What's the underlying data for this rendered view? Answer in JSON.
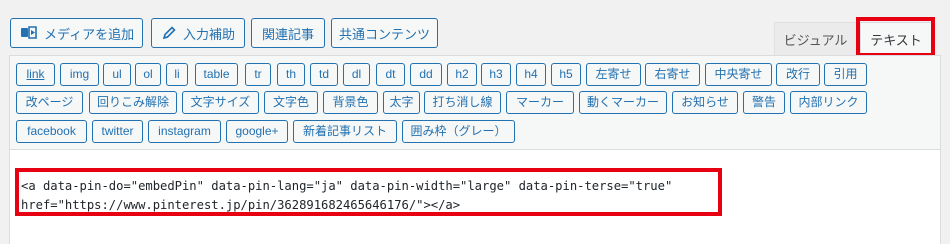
{
  "media_buttons": {
    "add_media": "メディアを追加",
    "input_assist": "入力補助",
    "related_article": "関連記事",
    "shared_content": "共通コンテンツ"
  },
  "tabs": {
    "visual": "ビジュアル",
    "text": "テキスト"
  },
  "quicktags": {
    "row1": [
      "link",
      "img",
      "ul",
      "ol",
      "li",
      "table",
      "tr",
      "th",
      "td",
      "dl",
      "dt",
      "dd",
      "h2",
      "h3",
      "h4",
      "h5",
      "左寄せ",
      "右寄せ",
      "中央寄せ",
      "改行",
      "引用"
    ],
    "row2": [
      "改ページ",
      "回りこみ解除",
      "文字サイズ",
      "文字色",
      "背景色",
      "太字",
      "打ち消し線",
      "マーカー",
      "動くマーカー",
      "お知らせ",
      "警告",
      "内部リンク"
    ],
    "row3": [
      "facebook",
      "twitter",
      "instagram",
      "google+",
      "新着記事リスト",
      "囲み枠（グレー）"
    ]
  },
  "editor": {
    "line1": "<a data-pin-do=\"embedPin\" data-pin-lang=\"ja\" data-pin-width=\"large\" data-pin-terse=\"true\"",
    "line2": "href=\"https://www.pinterest.jp/pin/362891682465646176/\"></a>"
  },
  "colors": {
    "accent": "#2271b1",
    "highlight": "#e60012"
  }
}
